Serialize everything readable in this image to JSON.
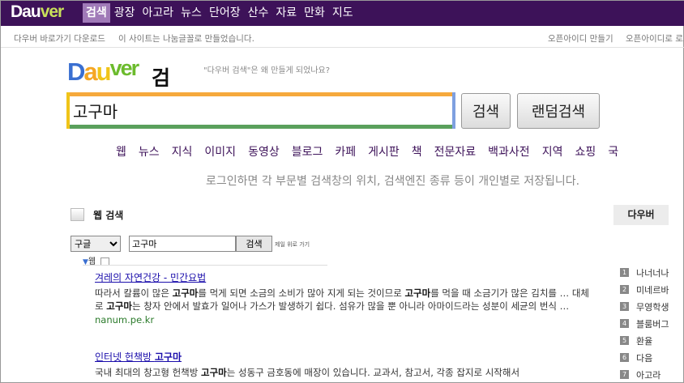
{
  "topbar": {
    "logo_left": "Dau",
    "logo_right": "ver",
    "nav": [
      "검색",
      "광장",
      "아고라",
      "뉴스",
      "단어장",
      "산수",
      "자료",
      "만화",
      "지도"
    ]
  },
  "utility": {
    "left1": "다우버 바로가기 다운로드",
    "left2": "이 사이트는 나눔글꼴로 만들었습니다.",
    "right1": "오픈아이디 만들기",
    "right2": "오픈아이디로 로그인"
  },
  "brand": {
    "title": "검색",
    "tagline": "\"다우버 검색\"은 왜 만들게 되었나요?"
  },
  "search": {
    "query": "고구마",
    "search_label": "검색",
    "random_label": "랜덤검색"
  },
  "categories": [
    "웹",
    "뉴스",
    "지식",
    "이미지",
    "동영상",
    "블로그",
    "카페",
    "게시판",
    "책",
    "전문자료",
    "백과사전",
    "지역",
    "쇼핑",
    "국"
  ],
  "notice": "로그인하면 각 부문별 검색창의 위치, 검색엔진 종류 등이 개인별로 저장됩니다.",
  "web_section": {
    "label": "웹 검색",
    "engine": "구글",
    "query": "고구마",
    "button": "검색",
    "small_link": "제일 위로 가기",
    "tab": "웹"
  },
  "results": [
    {
      "title": "겨레의 자연건강 - 민간요법",
      "snippet_html": "따라서 칼륨이 많은 <b>고구마</b>를 먹게 되면 소금의 소비가 많아 지게 되는 것이므로 <b>고구마</b>를 먹을 때 소금기가 많은 김치를 … 대체로 <b>고구마</b>는 창자 안에서 발효가 일어나 가스가 발생하기 쉽다. 섬유가 많을 뿐 아니라 아마이드라는 성분이 세균의 번식 …",
      "url": "nanum.pe.kr"
    },
    {
      "title": "인터넷 헌책방 고구마",
      "snippet_html": "국내 최대의 창고형 헌책방 <b>고구마</b>는 성동구 금호동에 매장이 있습니다. 교과서, 참고서, 각종 잡지로 시작해서",
      "url": ""
    }
  ],
  "sidebar": {
    "header": "다우버",
    "items": [
      {
        "n": "1",
        "label": "나너너나"
      },
      {
        "n": "2",
        "label": "미네르바"
      },
      {
        "n": "3",
        "label": "무영학생"
      },
      {
        "n": "4",
        "label": "블룸버그"
      },
      {
        "n": "5",
        "label": "환율"
      },
      {
        "n": "6",
        "label": "다음"
      },
      {
        "n": "7",
        "label": "아고라"
      }
    ]
  },
  "colors": {
    "topbar": "#3d1259",
    "active_tab": "#a07ab8",
    "link": "#1a0dab"
  }
}
